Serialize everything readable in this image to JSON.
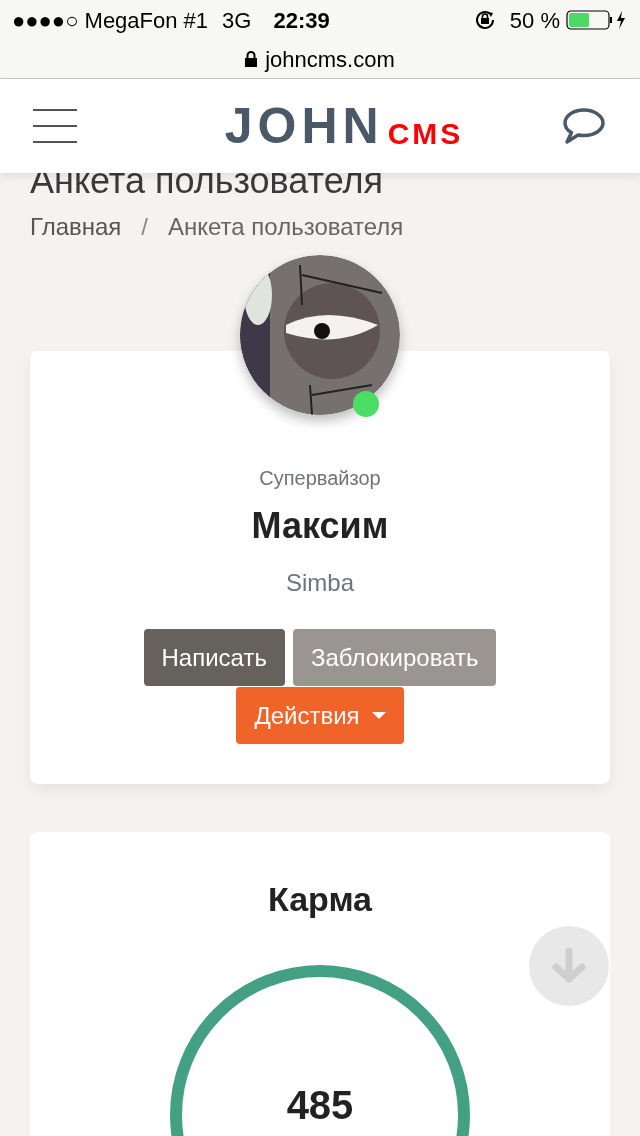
{
  "status_bar": {
    "carrier": "●●●●○ MegaFon #1",
    "network": "3G",
    "time": "22:39",
    "battery": "50 %"
  },
  "url_bar": {
    "address": "johncms.com"
  },
  "header": {
    "logo": {
      "main": "JOHN",
      "suffix": "CMS"
    }
  },
  "page": {
    "title": "Анкета пользователя",
    "breadcrumbs": [
      {
        "label": "Главная",
        "current": false
      },
      {
        "label": "Анкета пользователя",
        "current": true
      }
    ],
    "separator": "/"
  },
  "profile": {
    "avatar": {
      "kind": "picture",
      "online": true
    },
    "role": "Супервайзор",
    "name": "Максим",
    "nickname": "Simba",
    "buttons": [
      {
        "label": "Написать",
        "kind": "primary"
      },
      {
        "label": "Заблокировать",
        "kind": "secondary"
      },
      {
        "label": "Действия",
        "kind": "dropdown"
      }
    ]
  },
  "karma": {
    "title": "Карма",
    "value": "485"
  }
}
